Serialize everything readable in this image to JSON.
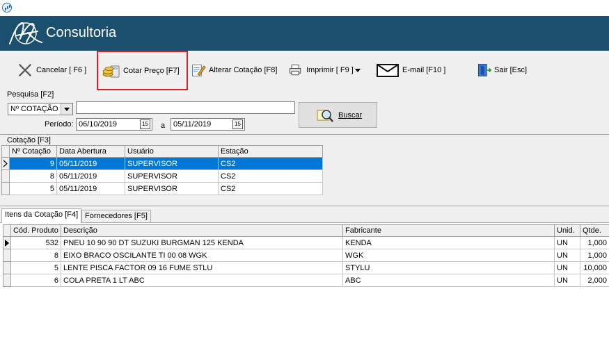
{
  "window": {
    "icon": "app-chart-icon"
  },
  "banner": {
    "brand": "Consultoria",
    "logo": "logo-signature"
  },
  "toolbar": {
    "cancel": {
      "label": "Cancelar [ F6 ]",
      "icon": "close-x-icon"
    },
    "quote": {
      "label": "Cotar Preço [F7]",
      "icon": "coins-calculator-icon"
    },
    "edit": {
      "label": "Alterar Cotação [F8]",
      "icon": "edit-document-icon"
    },
    "print": {
      "label": "Imprimir [ F9 ]",
      "icon": "printer-icon"
    },
    "email": {
      "label": "E-mail  [F10 ]",
      "icon": "envelope-icon"
    },
    "exit": {
      "label": "Sair  [Esc]",
      "icon": "exit-door-icon"
    }
  },
  "search": {
    "title": "Pesquisa [F2]",
    "field_selected": "Nº COTAÇÃO",
    "query": "",
    "period_label": "Período:",
    "date_from": "06/10/2019",
    "date_to": "05/11/2019",
    "sep": "a",
    "button": "Buscar",
    "calendar_glyph": "15"
  },
  "quotes": {
    "title": "Cotação [F3]",
    "columns": [
      "Nº Cotação",
      "Data Abertura",
      "Usuário",
      "Estação"
    ],
    "rows": [
      [
        "9",
        "05/11/2019",
        "SUPERVISOR",
        "CS2"
      ],
      [
        "8",
        "05/11/2019",
        "SUPERVISOR",
        "CS2"
      ],
      [
        "5",
        "05/11/2019",
        "SUPERVISOR",
        "CS2"
      ]
    ]
  },
  "tabs": {
    "items": "Itens da Cotação [F4]",
    "suppliers": "Fornecedores [F5]"
  },
  "items": {
    "columns": [
      "Cód. Produto",
      "Descrição",
      "Fabricante",
      "Unid.",
      "Qtde."
    ],
    "rows": [
      [
        "532",
        "PNEU 10 90 90 DT  SUZUKI BURGMAN 125 KENDA",
        "KENDA",
        "UN",
        "1,000"
      ],
      [
        "8",
        "EIXO BRACO OSCILANTE TI 00 08 WGK",
        "WGK",
        "UN",
        "1,000"
      ],
      [
        "5",
        "LENTE PISCA FACTOR 09 16 FUME STLU",
        "STYLU",
        "UN",
        "10,000"
      ],
      [
        "6",
        "COLA PRETA 1 LT ABC",
        "ABC",
        "UN",
        "2,000"
      ]
    ]
  }
}
